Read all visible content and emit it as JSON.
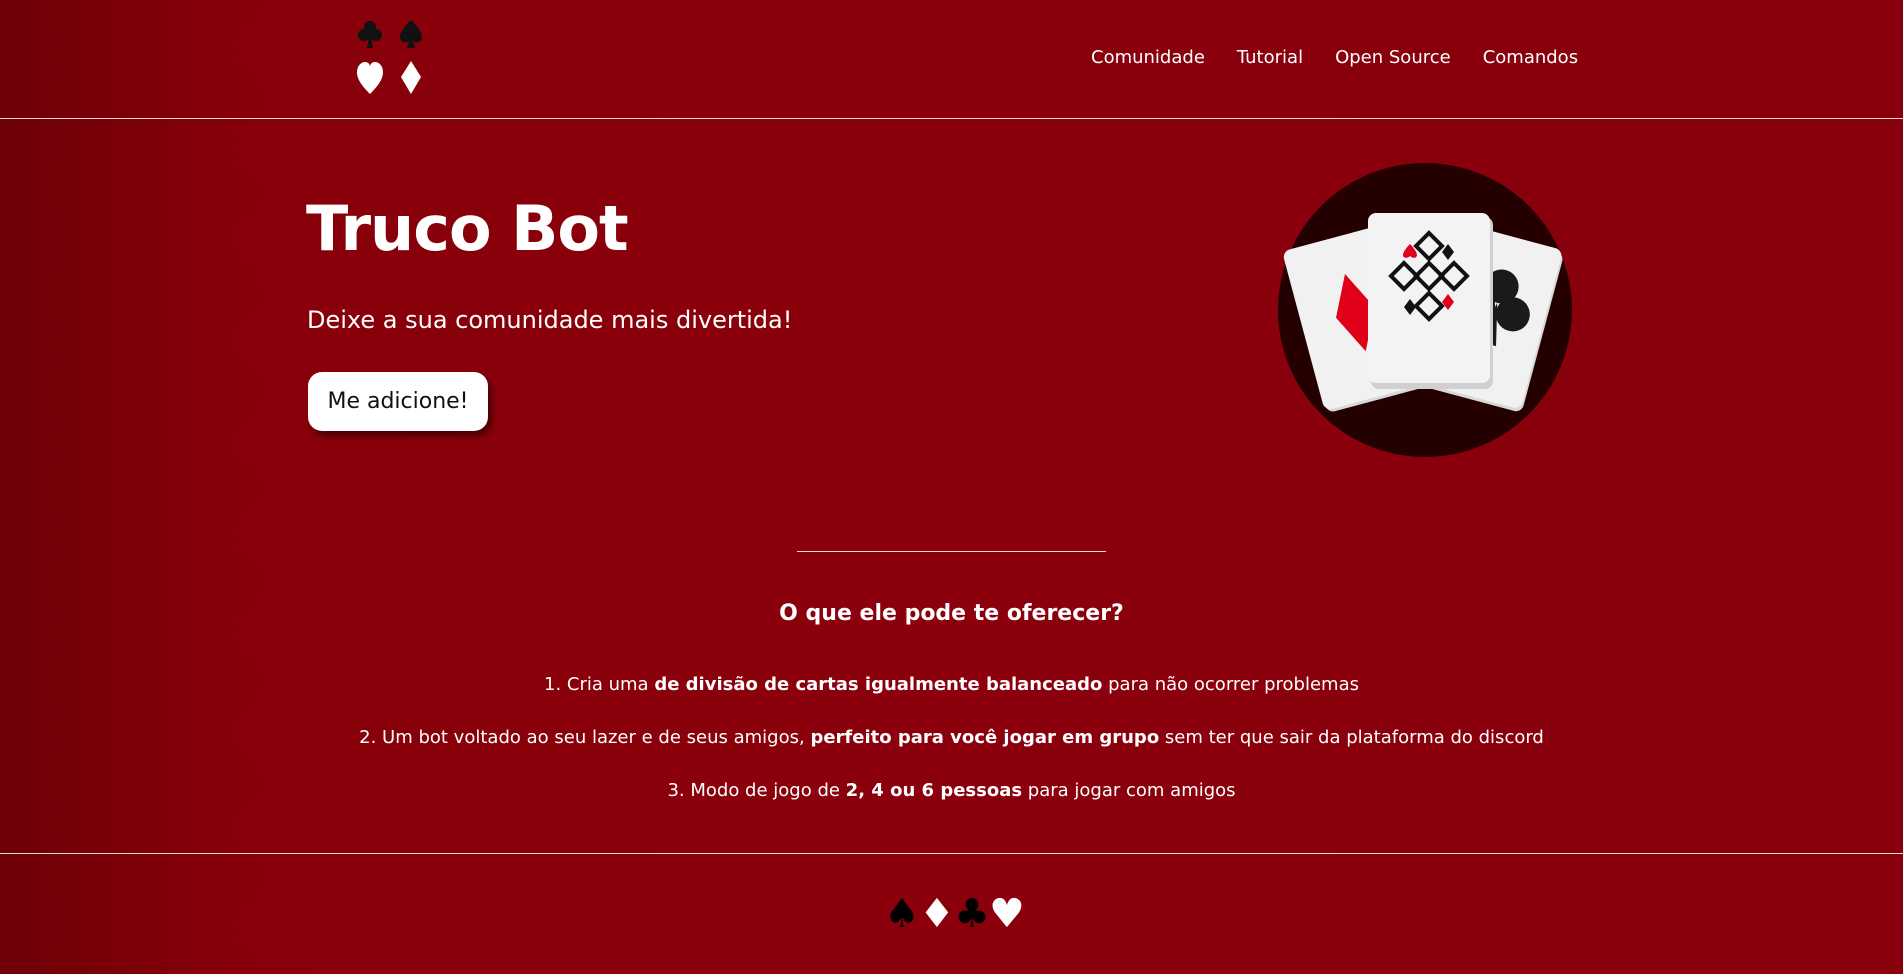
{
  "header": {
    "logo_icon": "card-suits-logo-icon",
    "nav": [
      {
        "label": "Comunidade"
      },
      {
        "label": "Tutorial"
      },
      {
        "label": "Open Source"
      },
      {
        "label": "Comandos"
      }
    ]
  },
  "hero": {
    "title": "Truco Bot",
    "subtitle": "Deixe a sua comunidade mais divertida!",
    "button_label": "Me adicione!",
    "illustration_icon": "playing-cards-icon"
  },
  "features": {
    "title": "O que ele pode te oferecer?",
    "items": [
      {
        "prefix": "1. Cria uma ",
        "bold": "de divisão de cartas igualmente balanceado",
        "suffix": " para não ocorrer problemas"
      },
      {
        "prefix": "2. Um bot voltado ao seu lazer e de seus amigos, ",
        "bold": "perfeito para você jogar em grupo",
        "suffix": " sem ter que sair da plataforma do discord"
      },
      {
        "prefix": "3. Modo de jogo de ",
        "bold": "2, 4 ou 6 pessoas",
        "suffix": " para jogar com amigos"
      }
    ]
  },
  "footer": {
    "suits": [
      "♠",
      "♦",
      "♣",
      "♥"
    ]
  },
  "colors": {
    "background": "#8b000c",
    "background_dark": "#6e0008",
    "text": "#ffffff",
    "button_bg": "#ffffff",
    "suit_red": "#d6001a",
    "card_circle": "#2a0000"
  }
}
